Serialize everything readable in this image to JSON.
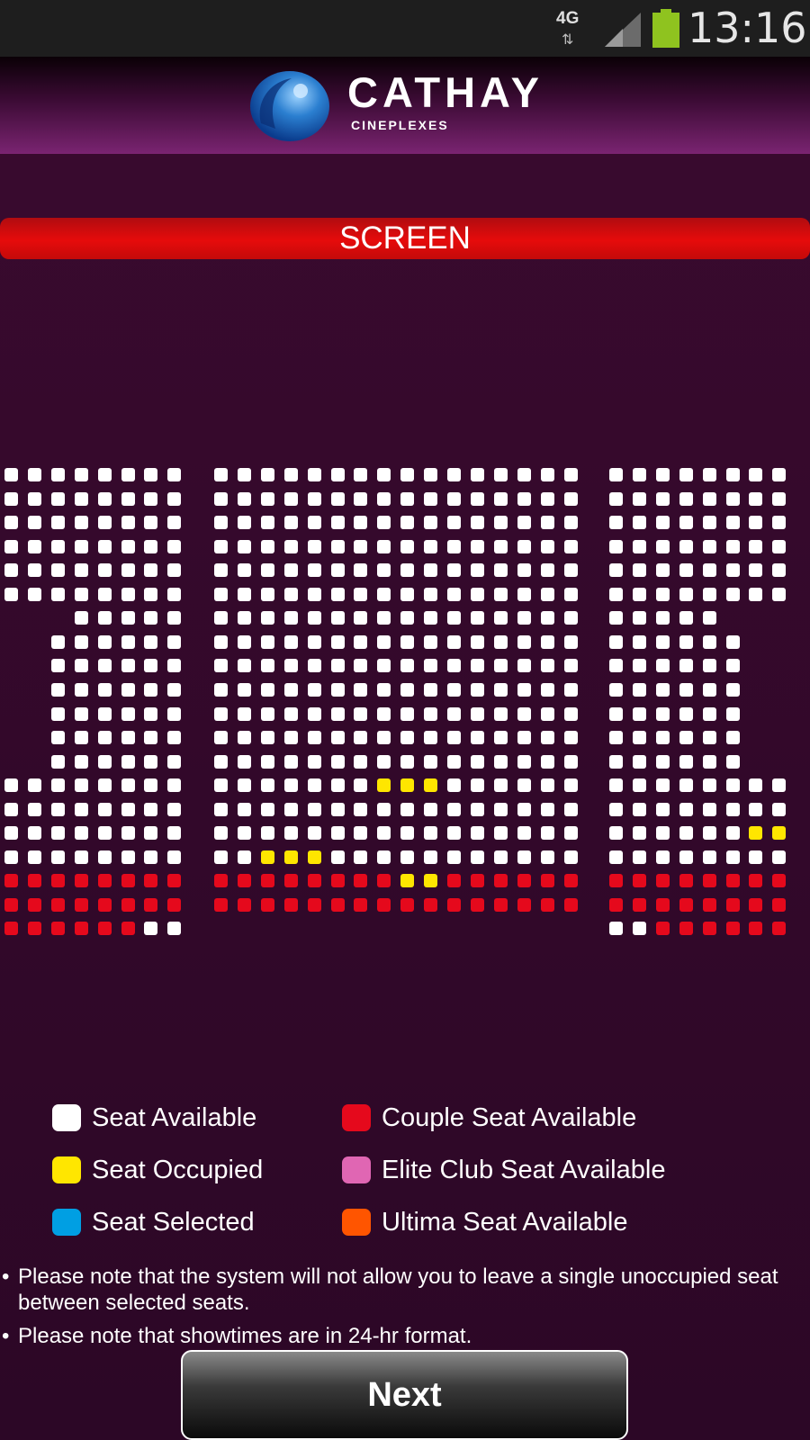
{
  "status_bar": {
    "network": "4G",
    "time": "13:16",
    "icons": [
      "data-arrows-icon",
      "signal-icon",
      "battery-icon"
    ],
    "battery_color": "#8fc31f"
  },
  "header": {
    "brand": "CATHAY",
    "brand_sub": "CINEPLEXES",
    "logo_icon": "cathay-globe-logo",
    "background_accent": "#7a2471"
  },
  "screen_label": "SCREEN",
  "seat_colors": {
    "available": "#ffffff",
    "occupied": "#ffe600",
    "selected": "#009fe3",
    "couple": "#e5091c",
    "elite": "#e066b3",
    "ultima": "#ff5500"
  },
  "seat_map": {
    "legend_codes": {
      "W": "available",
      "Y": "occupied",
      "R": "couple",
      "_": "no seat"
    },
    "blocks": [
      {
        "name": "left",
        "rows": [
          "WWWWWWWW",
          "WWWWWWWW",
          "WWWWWWWW",
          "WWWWWWWW",
          "WWWWWWWW",
          "WWWWWWWW",
          "___WWWWW",
          "__WWWWWW",
          "__WWWWWW",
          "__WWWWWW",
          "__WWWWWW",
          "__WWWWWW",
          "__WWWWWW",
          "WWWWWWWW",
          "WWWWWWWW",
          "WWWWWWWW",
          "WWWWWWWW",
          "RRRRRRRR",
          "RRRRRRRR",
          "RRRRRRWW"
        ]
      },
      {
        "name": "center",
        "rows": [
          "WWWWWWWWWWWWWWWW",
          "WWWWWWWWWWWWWWWW",
          "WWWWWWWWWWWWWWWW",
          "WWWWWWWWWWWWWWWW",
          "WWWWWWWWWWWWWWWW",
          "WWWWWWWWWWWWWWWW",
          "WWWWWWWWWWWWWWWW",
          "WWWWWWWWWWWWWWWW",
          "WWWWWWWWWWWWWWWW",
          "WWWWWWWWWWWWWWWW",
          "WWWWWWWWWWWWWWWW",
          "WWWWWWWWWWWWWWWW",
          "WWWWWWWWWWWWWWWW",
          "WWWWWWWYYYWWWWWW",
          "WWWWWWWWWWWWWWWW",
          "WWWWWWWWWWWWWWWW",
          "WWYYYWWWWWWWWWWW",
          "RRRRRRRRRRRRRRRR",
          "RRRRRRRRRRRRRRRR",
          "________________"
        ]
      },
      {
        "name": "right",
        "rows": [
          "WWWWWWWW",
          "WWWWWWWW",
          "WWWWWWWW",
          "WWWWWWWW",
          "WWWWWWWW",
          "WWWWWWWW",
          "WWWWW___",
          "WWWWWW__",
          "WWWWWW__",
          "WWWWWW__",
          "WWWWWW__",
          "WWWWWW__",
          "WWWWWW__",
          "WWWWWWWW",
          "WWWWWWWW",
          "WWWWWWYY",
          "WWWWWWWW",
          "RRRRRRRR",
          "RRRRRRRR",
          "WWRRRRRR"
        ]
      }
    ],
    "center_row_17_override": "WWWWWWWWYYWWWWWW"
  },
  "legend": [
    {
      "label": "Seat Available",
      "color": "#ffffff"
    },
    {
      "label": "Couple Seat Available",
      "color": "#e5091c"
    },
    {
      "label": "Seat Occupied",
      "color": "#ffe600"
    },
    {
      "label": "Elite Club Seat Available",
      "color": "#e066b3"
    },
    {
      "label": "Seat Selected",
      "color": "#009fe3"
    },
    {
      "label": "Ultima Seat Available",
      "color": "#ff5500"
    }
  ],
  "notes": [
    "Please note that the system will not allow you to leave a single unoccupied seat between selected seats.",
    "Please note that showtimes are in 24-hr format."
  ],
  "bullet": "•",
  "next_label": "Next"
}
